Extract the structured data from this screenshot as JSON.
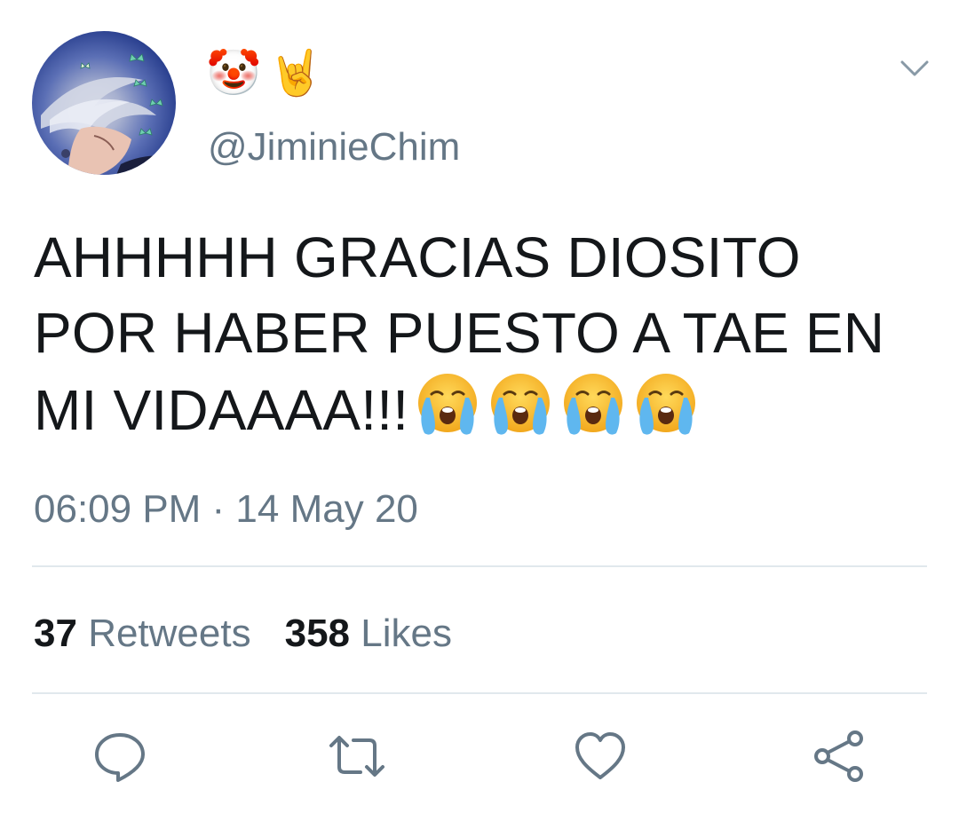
{
  "user": {
    "display_name_emojis": [
      "🤡",
      "🤘"
    ],
    "handle": "@JiminieChim",
    "avatar_description": "avatar"
  },
  "tweet": {
    "lines": [
      "AHHHHH GRACIAS DIOSITO",
      "POR HABER PUESTO A TAE EN",
      "MI VIDAAAA!!!"
    ],
    "trailing_emoji": "loudly-crying-face",
    "trailing_emoji_count": 4,
    "timestamp": "06:09 PM · 14 May 20"
  },
  "stats": {
    "retweets_count": "37",
    "retweets_label": "Retweets",
    "likes_count": "358",
    "likes_label": "Likes"
  },
  "actions": [
    {
      "icon": "reply-icon"
    },
    {
      "icon": "retweet-icon"
    },
    {
      "icon": "like-icon"
    },
    {
      "icon": "share-icon"
    }
  ],
  "colors": {
    "text_primary": "#14171a",
    "text_secondary": "#657786",
    "divider": "#e1e8ed"
  }
}
